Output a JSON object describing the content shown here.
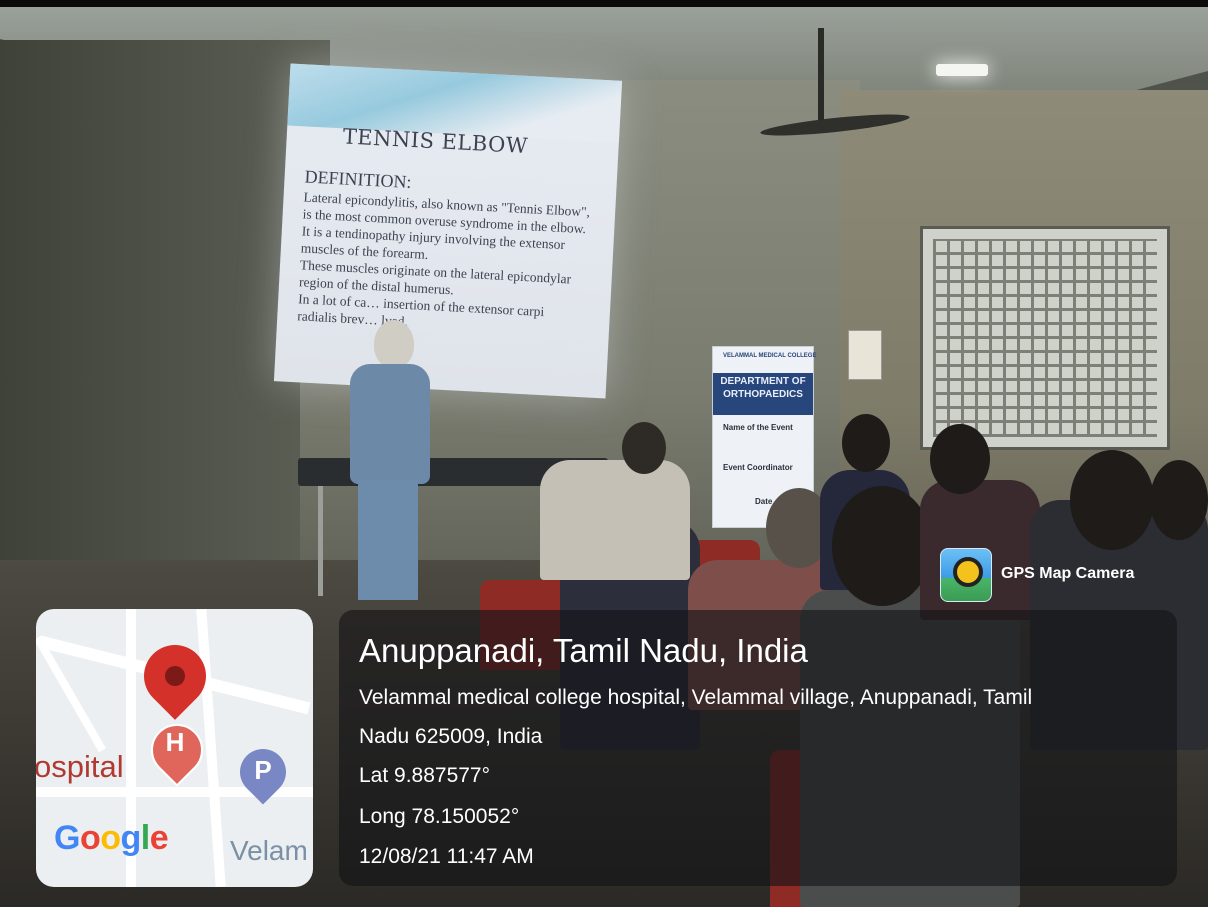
{
  "slide": {
    "title": "TENNIS ELBOW",
    "definition_heading": "DEFINITION:",
    "lines": [
      "Lateral epicondylitis, also known as \"Tennis Elbow\",",
      "is the most common overuse syndrome in the elbow.",
      "It is a tendinopathy injury involving the extensor",
      "muscles of the forearm.",
      "These muscles originate on the lateral epicondylar",
      "region of the distal humerus.",
      " In a lot of ca…  insertion of the extensor carpi",
      "radialis brev…  lved."
    ]
  },
  "banner": {
    "college": "VELAMMAL MEDICAL COLLEGE",
    "department_line1": "DEPARTMENT OF",
    "department_line2": "ORTHOPAEDICS",
    "event_label": "Name of the Event",
    "coordinator_label": "Event Coordinator",
    "date_label": "Date"
  },
  "map": {
    "place_label": "ospital",
    "area_label": "Velam",
    "hospital_icon_letter": "H",
    "parking_icon_letter": "P",
    "brand": [
      "G",
      "o",
      "o",
      "g",
      "l",
      "e"
    ]
  },
  "overlay": {
    "app_name": "GPS Map Camera",
    "location_title": "Anuppanadi, Tamil Nadu, India",
    "address_line1": "Velammal medical college hospital, Velammal village, Anuppanadi, Tamil",
    "address_line2": "Nadu 625009, India",
    "latitude": "Lat 9.887577°",
    "longitude": "Long 78.150052°",
    "timestamp": "12/08/21 11:47 AM"
  },
  "colors": {
    "overlay_panel": "#141416",
    "pin_red": "#d5312b",
    "google_blue": "#4285f4",
    "google_red": "#ea4335",
    "google_yellow": "#fbbc05",
    "google_green": "#34a853"
  },
  "icons": [
    "gps-map-camera-icon",
    "location-pin-icon",
    "hospital-icon",
    "parking-icon"
  ]
}
